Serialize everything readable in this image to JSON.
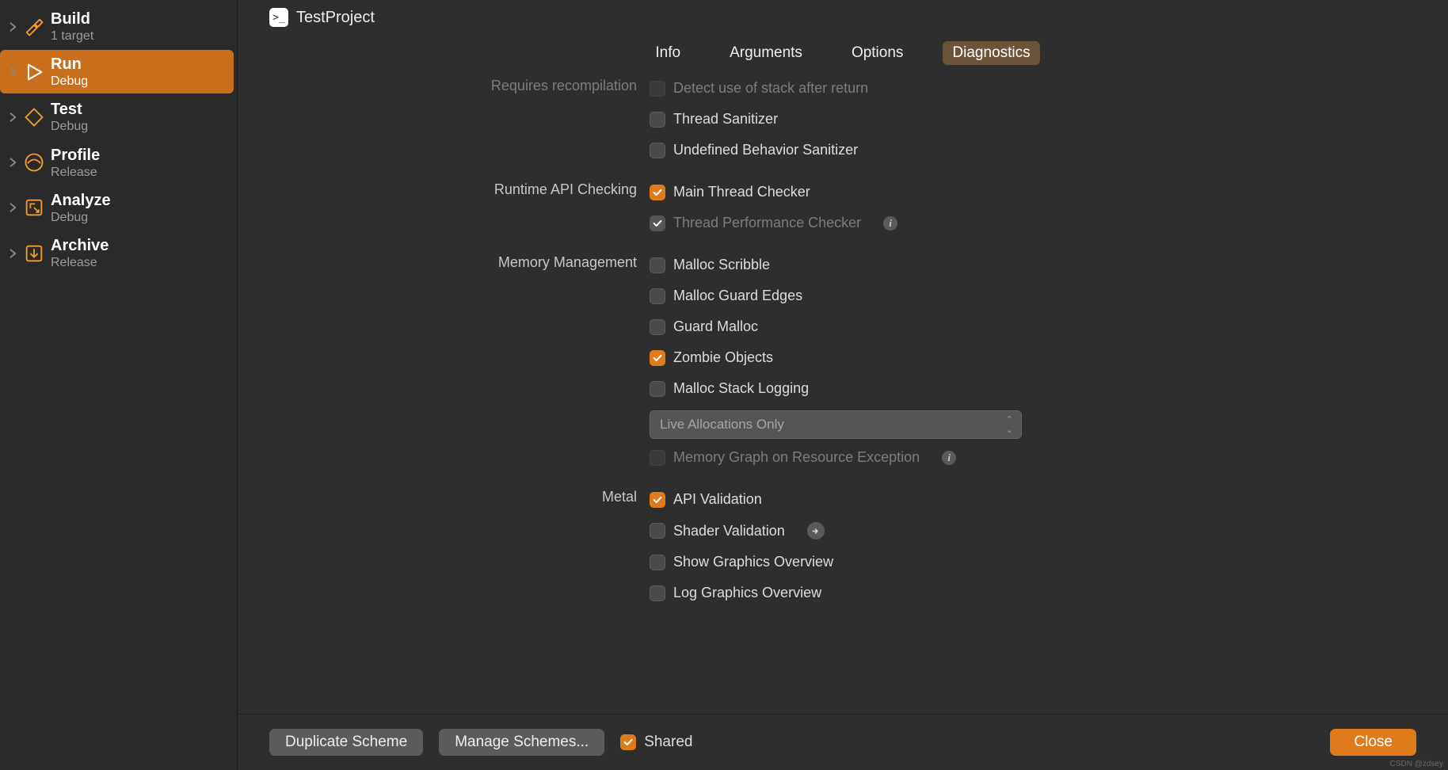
{
  "project_name": "TestProject",
  "sidebar": [
    {
      "title": "Build",
      "subtitle": "1 target",
      "icon": "hammer",
      "selected": false
    },
    {
      "title": "Run",
      "subtitle": "Debug",
      "icon": "play",
      "selected": true
    },
    {
      "title": "Test",
      "subtitle": "Debug",
      "icon": "diamond",
      "selected": false
    },
    {
      "title": "Profile",
      "subtitle": "Release",
      "icon": "gauge",
      "selected": false
    },
    {
      "title": "Analyze",
      "subtitle": "Debug",
      "icon": "analyze",
      "selected": false
    },
    {
      "title": "Archive",
      "subtitle": "Release",
      "icon": "archive",
      "selected": false
    }
  ],
  "tabs": [
    "Info",
    "Arguments",
    "Options",
    "Diagnostics"
  ],
  "selected_tab": "Diagnostics",
  "sections": {
    "recompile": {
      "label": "Requires recompilation",
      "opts": [
        {
          "label": "Detect use of stack after return",
          "checked": false,
          "disabled": true
        },
        {
          "label": "Thread Sanitizer",
          "checked": false,
          "disabled": false
        },
        {
          "label": "Undefined Behavior Sanitizer",
          "checked": false,
          "disabled": false
        }
      ]
    },
    "runtime": {
      "label": "Runtime API Checking",
      "opts": [
        {
          "label": "Main Thread Checker",
          "checked": true,
          "disabled": false
        },
        {
          "label": "Thread Performance Checker",
          "checked": true,
          "disabled": true,
          "info": true
        }
      ]
    },
    "memory": {
      "label": "Memory Management",
      "opts": [
        {
          "label": "Malloc Scribble",
          "checked": false,
          "disabled": false
        },
        {
          "label": "Malloc Guard Edges",
          "checked": false,
          "disabled": false
        },
        {
          "label": "Guard Malloc",
          "checked": false,
          "disabled": false
        },
        {
          "label": "Zombie Objects",
          "checked": true,
          "disabled": false
        },
        {
          "label": "Malloc Stack Logging",
          "checked": false,
          "disabled": false
        }
      ],
      "popup": "Live Allocations Only",
      "extra": [
        {
          "label": "Memory Graph on Resource Exception",
          "checked": false,
          "disabled": true,
          "info": true
        }
      ]
    },
    "metal": {
      "label": "Metal",
      "opts": [
        {
          "label": "API Validation",
          "checked": true,
          "disabled": false
        },
        {
          "label": "Shader Validation",
          "checked": false,
          "disabled": false,
          "arrow": true
        },
        {
          "label": "Show Graphics Overview",
          "checked": false,
          "disabled": false
        },
        {
          "label": "Log Graphics Overview",
          "checked": false,
          "disabled": false
        }
      ]
    }
  },
  "footer": {
    "duplicate": "Duplicate Scheme",
    "manage": "Manage Schemes...",
    "shared_label": "Shared",
    "shared_checked": true,
    "close": "Close"
  },
  "watermark": "CSDN @zdsey"
}
